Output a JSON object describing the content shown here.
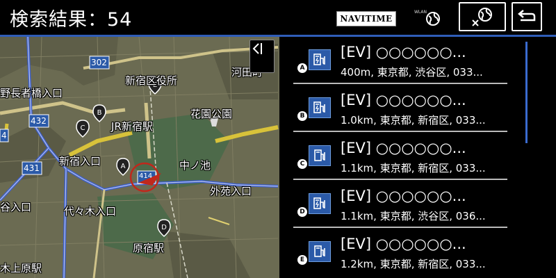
{
  "header": {
    "title": "検索結果：54",
    "navitime_label": "NAVITIME",
    "wlan_label": "WLAN"
  },
  "map": {
    "labels": {
      "shinjuku_ward_office": "新宿区役所",
      "kawada": "河田町",
      "hanazono": "花園公園",
      "nagano": "野長者橋入口",
      "jr_shinjuku": "JR新宿駅",
      "shinjuku_entrance": "新宿入口",
      "nakanoike": "中ノ池",
      "gaien_entrance": "外苑入口",
      "shibuya_entrance": "谷入口",
      "yoyogi_entrance": "代々木入口",
      "harajuku": "原宿駅",
      "kamihara": "木上原駅",
      "route_302": "302",
      "route_432": "432",
      "route_431": "431",
      "route_4": "4",
      "route_414": "414"
    },
    "pins": [
      "A",
      "B",
      "C",
      "D",
      "E"
    ]
  },
  "results": [
    {
      "marker": "A",
      "title": "[EV] ○○○○○○...",
      "sub": "400m, 東京都, 渋谷区, 033..."
    },
    {
      "marker": "B",
      "title": "[EV] ○○○○○○...",
      "sub": "1.0km, 東京都, 新宿区, 033..."
    },
    {
      "marker": "C",
      "title": "[EV] ○○○○○○...",
      "sub": "1.1km, 東京都, 新宿区, 033..."
    },
    {
      "marker": "D",
      "title": "[EV] ○○○○○○...",
      "sub": "1.1km, 東京都, 渋谷区, 036..."
    },
    {
      "marker": "E",
      "title": "[EV] ○○○○○○...",
      "sub": "1.2km, 東京都, 新宿区, 033..."
    }
  ],
  "colors": {
    "accent": "#2f5db8",
    "ev_icon_bg": "#2b5aa8",
    "map_park": "#4d6a4a",
    "map_road_yellow": "#d8c23a",
    "map_road_blue": "#3b5fcf"
  }
}
